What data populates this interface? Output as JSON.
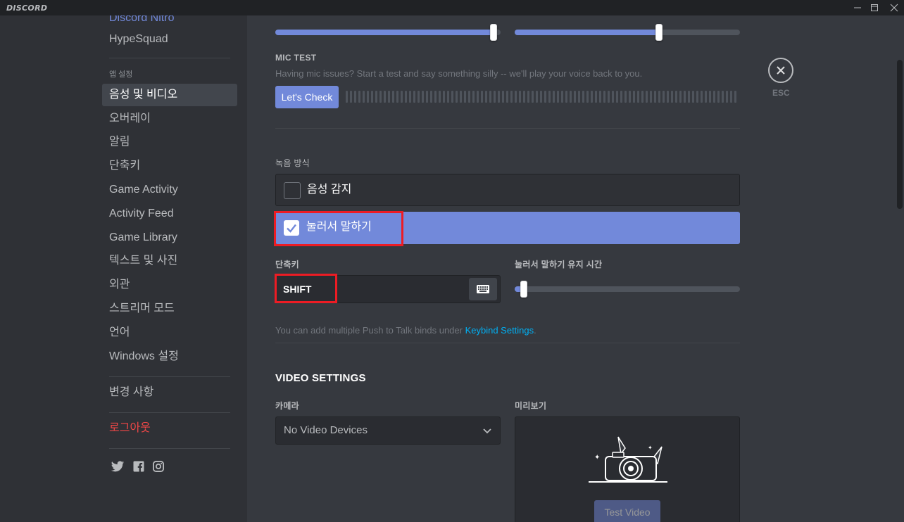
{
  "titlebar": {
    "logo": "DISCORD",
    "controls": [
      "minimize-icon",
      "maximize-icon",
      "close-icon"
    ]
  },
  "sidebar": {
    "top_partial_item": "Discord Nitro",
    "hypesquad": "HypeSquad",
    "app_settings_header": "앱 설정",
    "items": [
      {
        "label": "음성 및 비디오",
        "active": true
      },
      {
        "label": "오버레이"
      },
      {
        "label": "알림"
      },
      {
        "label": "단축키"
      },
      {
        "label": "Game Activity"
      },
      {
        "label": "Activity Feed"
      },
      {
        "label": "Game Library"
      },
      {
        "label": "텍스트 및 사진"
      },
      {
        "label": "외관"
      },
      {
        "label": "스트리머 모드"
      },
      {
        "label": "언어"
      },
      {
        "label": "Windows 설정"
      }
    ],
    "changelog": "변경 사항",
    "logout": "로그아웃",
    "social_icons": [
      "twitter-icon",
      "facebook-icon",
      "instagram-icon"
    ]
  },
  "voice": {
    "input_volume_fraction": 0.97,
    "output_volume_fraction": 0.64,
    "mic_test": {
      "title": "MIC TEST",
      "description": "Having mic issues? Start a test and say something silly -- we'll play your voice back to you.",
      "button": "Let's Check"
    },
    "input_mode": {
      "header": "녹음 방식",
      "options": [
        {
          "label": "음성 감지",
          "selected": false
        },
        {
          "label": "눌러서 말하기",
          "selected": true
        }
      ]
    },
    "shortcut": {
      "header": "단축키",
      "value": "SHIFT"
    },
    "ptt_delay": {
      "header": "눌러서 말하기 유지 시간",
      "value_fraction": 0.04
    },
    "keybind_note_prefix": "You can add multiple Push to Talk binds under ",
    "keybind_note_link": "Keybind Settings",
    "keybind_note_suffix": "."
  },
  "video": {
    "section_title": "VIDEO SETTINGS",
    "camera_header": "카메라",
    "camera_value": "No Video Devices",
    "preview_header": "미리보기",
    "test_button": "Test Video"
  },
  "close": {
    "label": "ESC"
  },
  "colors": {
    "brand": "#7289da",
    "highlight": "#ed1c24",
    "link": "#00b0f4",
    "danger": "#f04747"
  }
}
